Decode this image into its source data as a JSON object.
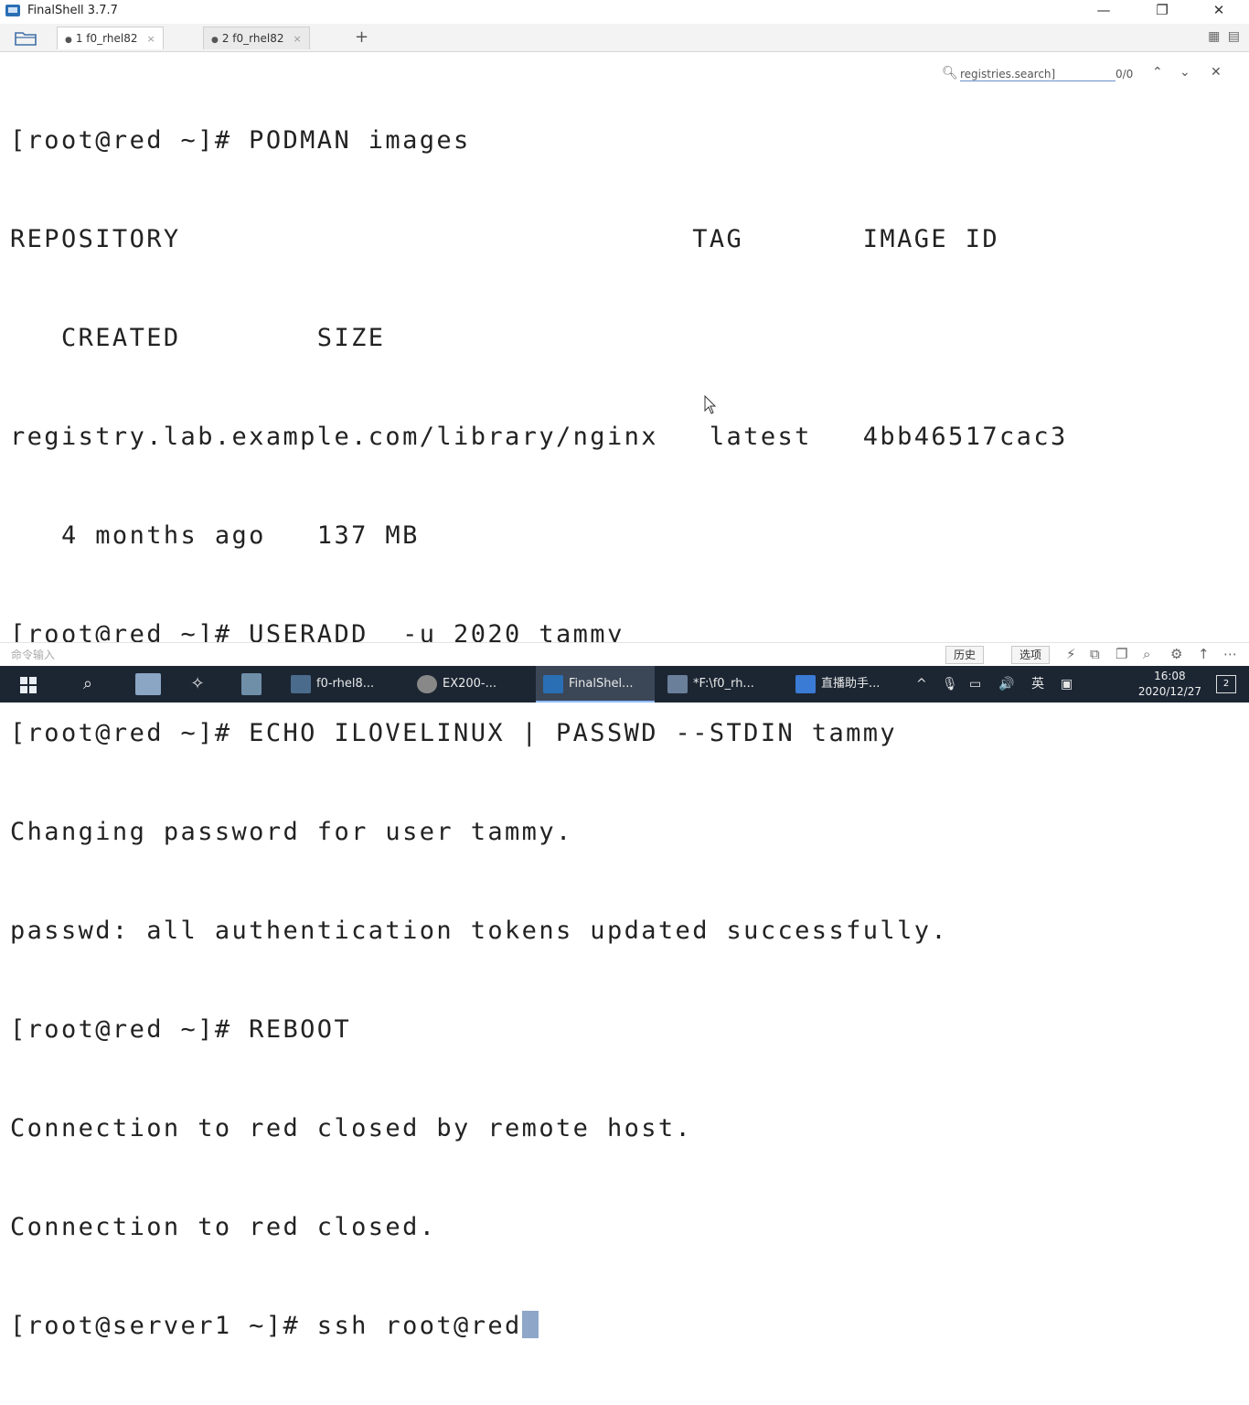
{
  "window": {
    "title": "FinalShell 3.7.7",
    "minimize": "—",
    "maximize": "❐",
    "close": "✕"
  },
  "tabs": [
    {
      "label": "1 f0_rhel82",
      "close": "×"
    },
    {
      "label": "2 f0_rhel82",
      "close": "×"
    }
  ],
  "tab_add": "+",
  "layout_icons": "▦ ▤",
  "search": {
    "placeholder": "registries.search]",
    "count": "0/0",
    "prev": "⌃",
    "next": "⌄",
    "close": "✕"
  },
  "terminal": {
    "lines": [
      "[root@red ~]# PODMAN images",
      "REPOSITORY                              TAG       IMAGE ID",
      "   CREATED        SIZE",
      "registry.lab.example.com/library/nginx   latest   4bb46517cac3",
      "   4 months ago   137 MB",
      "[root@red ~]# USERADD  -u 2020 tammy",
      "[root@red ~]# ECHO ILOVELINUX | PASSWD --STDIN tammy",
      "Changing password for user tammy.",
      "passwd: all authentication tokens updated successfully.",
      "[root@red ~]# REBOOT",
      "Connection to red closed by remote host.",
      "Connection to red closed.",
      "[root@server1 ~]# ssh root@red"
    ]
  },
  "command_bar": {
    "placeholder": "命令输入",
    "history_label": "历史",
    "options_label": "选项",
    "icons": [
      "⚡",
      "⧉",
      "❐",
      "⌕",
      "⚙",
      "↑",
      "⋯"
    ]
  },
  "taskbar": {
    "items": [
      {
        "label": "f0-rhel8...",
        "color": "#4a6b8c"
      },
      {
        "label": "EX200-...",
        "color": "#888888"
      },
      {
        "label": "FinalShel...",
        "color": "#2a6fb4"
      },
      {
        "label": "*F:\\f0_rh...",
        "color": "#6a7f9a"
      },
      {
        "label": "直播助手...",
        "color": "#3a7bd5"
      }
    ],
    "tray": {
      "chevron": "^",
      "mic": "🎙",
      "network": "▭",
      "volume": "🔊",
      "ime": "英",
      "chat": "▣"
    },
    "time": "16:08",
    "date": "2020/12/27",
    "notifications": "2"
  }
}
